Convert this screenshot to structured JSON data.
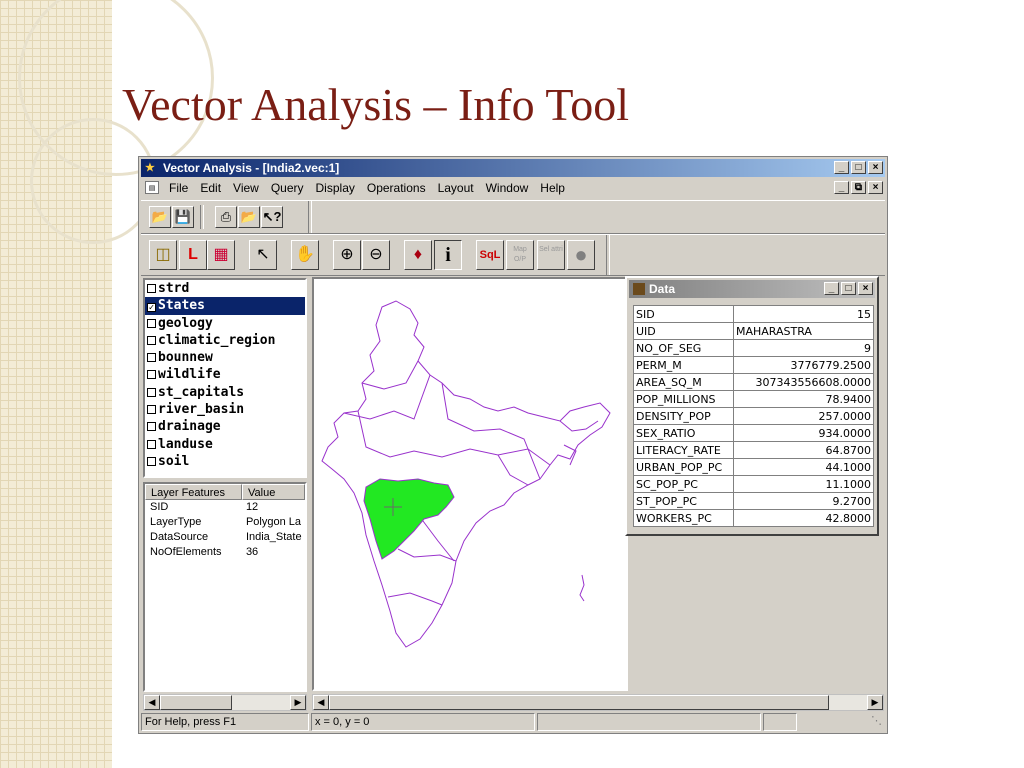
{
  "slide": {
    "title": "Vector Analysis – Info Tool"
  },
  "window": {
    "title": "Vector Analysis - [India2.vec:1]",
    "controls": {
      "minimize": "_",
      "restore": "□",
      "close": "×"
    }
  },
  "menu": {
    "items": [
      "File",
      "Edit",
      "View",
      "Query",
      "Display",
      "Operations",
      "Layout",
      "Window",
      "Help"
    ],
    "mdi_controls": {
      "minimize": "_",
      "restore": "6",
      "close": "×"
    }
  },
  "toolbar": {
    "sql_label": "SqL",
    "map_op_label": "Map O/P",
    "sel_attr_label": "Sel attri",
    "info_label": "i"
  },
  "layers": {
    "items": [
      {
        "label": "strd",
        "checked": false
      },
      {
        "label": "States",
        "checked": true
      },
      {
        "label": "geology",
        "checked": false
      },
      {
        "label": "climatic_region",
        "checked": false
      },
      {
        "label": "bounnew",
        "checked": false
      },
      {
        "label": "wildlife",
        "checked": false
      },
      {
        "label": "st_capitals",
        "checked": false
      },
      {
        "label": "river_basin",
        "checked": false
      },
      {
        "label": "drainage",
        "checked": false
      },
      {
        "label": "landuse",
        "checked": false
      },
      {
        "label": "soil",
        "checked": false
      }
    ],
    "checkmark": "✓"
  },
  "layer_features": {
    "headers": [
      "Layer Features",
      "Value"
    ],
    "rows": [
      [
        "SID",
        "12"
      ],
      [
        "LayerType",
        "Polygon La"
      ],
      [
        "DataSource",
        "India_State"
      ],
      [
        "NoOfElements",
        "36"
      ]
    ]
  },
  "status": {
    "help": "For Help, press F1",
    "coords": "x = 0,   y = 0"
  },
  "data_window": {
    "title": "Data",
    "rows": [
      [
        "SID",
        "15"
      ],
      [
        "UID",
        "MAHARASTRA"
      ],
      [
        "NO_OF_SEG",
        "9"
      ],
      [
        "PERM_M",
        "3776779.2500"
      ],
      [
        "AREA_SQ_M",
        "307343556608.0000"
      ],
      [
        "POP_MILLIONS",
        "78.9400"
      ],
      [
        "DENSITY_POP",
        "257.0000"
      ],
      [
        "SEX_RATIO",
        "934.0000"
      ],
      [
        "LITERACY_RATE",
        "64.8700"
      ],
      [
        "URBAN_POP_PC",
        "44.1000"
      ],
      [
        "SC_POP_PC",
        "11.1000"
      ],
      [
        "ST_POP_PC",
        "9.2700"
      ],
      [
        "WORKERS_PC",
        "42.8000"
      ]
    ]
  },
  "map": {
    "outline_color": "#9932cc",
    "highlight_color": "#22e822",
    "highlighted_state": "MAHARASTRA"
  }
}
